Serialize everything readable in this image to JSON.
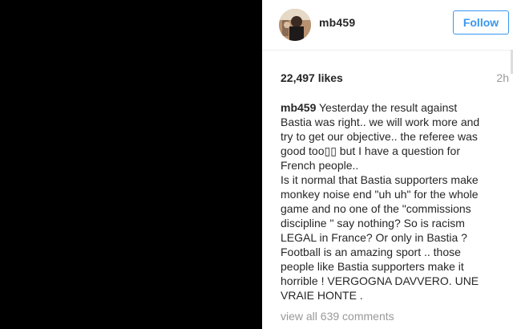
{
  "post": {
    "username": "mb459",
    "follow_label": "Follow",
    "likes": "22,497 likes",
    "time": "2h",
    "caption_user": "mb459",
    "caption_lines": [
      " Yesterday the result against",
      "Bastia was right.. we will work more and",
      "try to get our objective.. the referee was",
      "good too▯▯ but I have a question for",
      "French people..",
      "Is it normal that Bastia supporters make",
      "monkey noise end \"uh uh\" for the whole",
      "game and no one of the \"commissions",
      "discipline \" say nothing? So is racism",
      "LEGAL in France? Or only in Bastia ?",
      "Football is an amazing sport .. those",
      "people like Bastia supporters make it",
      "horrible ! VERGOGNA DAVVERO. UNE",
      "VRAIE HONTE ."
    ],
    "view_all": "view all 639 comments"
  },
  "colors": {
    "accent": "#3897f0",
    "text": "#262626",
    "muted": "#999999",
    "media_bg": "#000000"
  },
  "icons": {
    "avatar": "profile-photo"
  }
}
